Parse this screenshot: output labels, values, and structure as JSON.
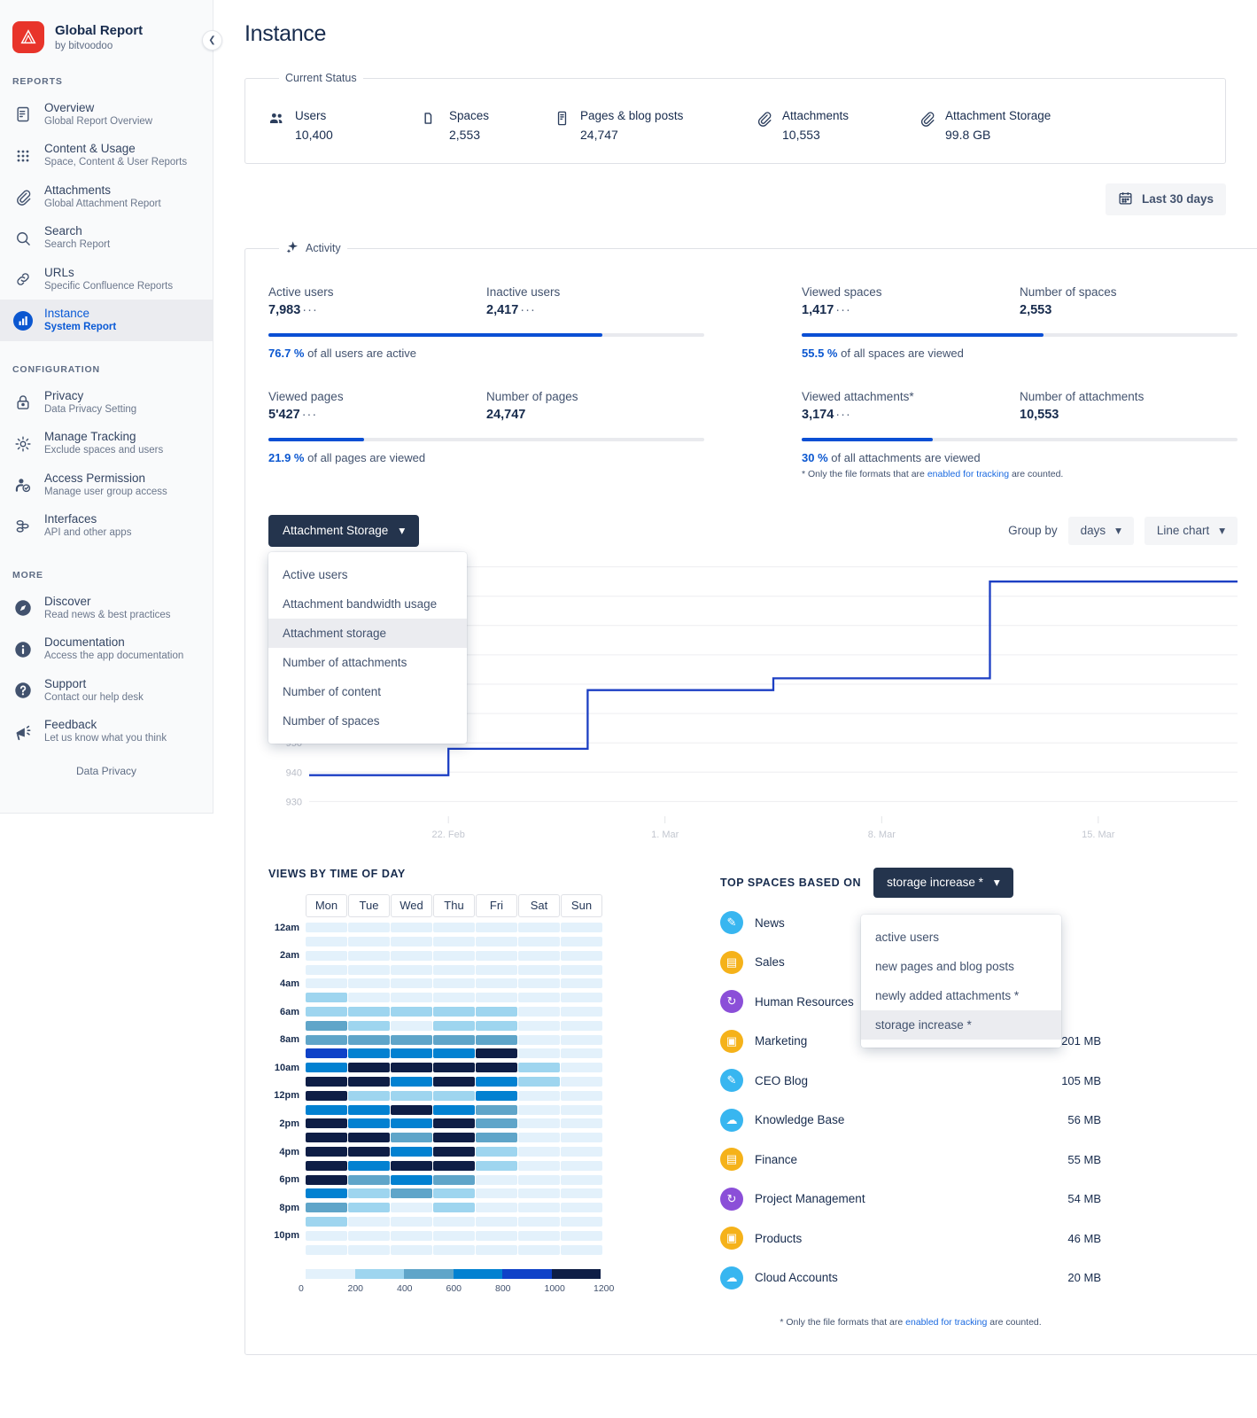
{
  "sidebar": {
    "brand": {
      "title": "Global Report",
      "subtitle": "by bitvoodoo"
    },
    "sections": [
      {
        "label": "REPORTS",
        "items": [
          {
            "title": "Overview",
            "subtitle": "Global Report Overview",
            "icon": "document-icon",
            "active": false
          },
          {
            "title": "Content & Usage",
            "subtitle": "Space, Content & User Reports",
            "icon": "grid-icon",
            "active": false
          },
          {
            "title": "Attachments",
            "subtitle": "Global Attachment Report",
            "icon": "paperclip-icon",
            "active": false
          },
          {
            "title": "Search",
            "subtitle": "Search Report",
            "icon": "search-icon",
            "active": false
          },
          {
            "title": "URLs",
            "subtitle": "Specific Confluence Reports",
            "icon": "link-icon",
            "active": false
          },
          {
            "title": "Instance",
            "subtitle": "System Report",
            "icon": "chart-icon",
            "active": true
          }
        ]
      },
      {
        "label": "CONFIGURATION",
        "items": [
          {
            "title": "Privacy",
            "subtitle": "Data Privacy Setting",
            "icon": "lock-icon",
            "active": false
          },
          {
            "title": "Manage Tracking",
            "subtitle": "Exclude spaces and users",
            "icon": "gear-icon",
            "active": false
          },
          {
            "title": "Access Permission",
            "subtitle": "Manage user group access",
            "icon": "user-check-icon",
            "active": false
          },
          {
            "title": "Interfaces",
            "subtitle": "API and other apps",
            "icon": "nodes-icon",
            "active": false
          }
        ]
      },
      {
        "label": "MORE",
        "items": [
          {
            "title": "Discover",
            "subtitle": "Read news & best practices",
            "icon": "compass-icon",
            "active": false
          },
          {
            "title": "Documentation",
            "subtitle": "Access the app documentation",
            "icon": "info-icon",
            "active": false
          },
          {
            "title": "Support",
            "subtitle": "Contact our help desk",
            "icon": "question-icon",
            "active": false
          },
          {
            "title": "Feedback",
            "subtitle": "Let us know what you think",
            "icon": "megaphone-icon",
            "active": false
          }
        ]
      }
    ],
    "footer_link": "Data Privacy",
    "collapse_icon": "chevron-left-icon"
  },
  "header": {
    "title": "Instance"
  },
  "current_status": {
    "legend": "Current Status",
    "items": [
      {
        "label": "Users",
        "value": "10,400",
        "icon": "users-icon"
      },
      {
        "label": "Spaces",
        "value": "2,553",
        "icon": "folder-icon"
      },
      {
        "label": "Pages & blog posts",
        "value": "24,747",
        "icon": "page-icon"
      },
      {
        "label": "Attachments",
        "value": "10,553",
        "icon": "paperclip-icon"
      },
      {
        "label": "Attachment Storage",
        "value": "99.8 GB",
        "icon": "paperclip-icon"
      }
    ]
  },
  "date_range": {
    "label": "Last 30 days",
    "icon": "calendar-icon"
  },
  "activity": {
    "legend": "Activity",
    "legend_icon": "sparkle-icon",
    "cells": [
      {
        "left_label": "Active users",
        "left_value": "7,983",
        "left_dots": "···",
        "right_label": "Inactive users",
        "right_value": "2,417",
        "right_dots": "···",
        "percent": 76.7,
        "caption_value": "76.7 %",
        "caption_text": "of all users are active"
      },
      {
        "left_label": "Viewed spaces",
        "left_value": "1,417",
        "left_dots": "···",
        "right_label": "Number of spaces",
        "right_value": "2,553",
        "right_dots": "",
        "percent": 55.5,
        "caption_value": "55.5 %",
        "caption_text": "of all spaces are viewed"
      },
      {
        "left_label": "Viewed pages",
        "left_value": "5'427",
        "left_dots": "···",
        "right_label": "Number of pages",
        "right_value": "24,747",
        "right_dots": "",
        "percent": 21.9,
        "caption_value": "21.9 %",
        "caption_text": "of all pages are viewed"
      },
      {
        "left_label": "Viewed attachments*",
        "left_value": "3,174",
        "left_dots": "···",
        "right_label": "Number of attachments",
        "right_value": "10,553",
        "right_dots": "",
        "percent": 30,
        "caption_value": "30 %",
        "caption_text": "of all attachments are viewed",
        "note_pre": "* Only the file formats that are ",
        "note_link": "enabled for tracking",
        "note_post": " are counted."
      }
    ]
  },
  "chart_controls": {
    "metric_button": "Attachment Storage",
    "metric_menu_open": true,
    "metric_options": [
      "Active users",
      "Attachment bandwidth usage",
      "Attachment storage",
      "Number of attachments",
      "Number of content",
      "Number of spaces"
    ],
    "metric_selected": "Attachment storage",
    "group_by_label": "Group by",
    "group_by_value": "days",
    "chart_type_value": "Line chart",
    "chevron_icon": "chevron-down-icon"
  },
  "chart_data": {
    "type": "line",
    "title": "Attachment Storage",
    "xlabel": "",
    "ylabel": "",
    "grid": true,
    "legend": "none",
    "step": true,
    "line_color": "#1c3fc4",
    "xticks": [
      "22. Feb",
      "1. Mar",
      "8. Mar",
      "15. Mar"
    ],
    "yticks": [
      930,
      940,
      950,
      960,
      970,
      980,
      990,
      1000,
      1010
    ],
    "ylim": [
      925,
      1012
    ],
    "xlim": [
      0,
      30
    ],
    "x": [
      0,
      4.5,
      9,
      15,
      22,
      30
    ],
    "values": [
      939,
      948,
      968,
      972,
      1005,
      1005
    ],
    "series": [
      {
        "name": "Attachment storage (GB)",
        "values": [
          939,
          939,
          948,
          948,
          968,
          968,
          972,
          972,
          1005,
          1005
        ]
      }
    ]
  },
  "heatmap": {
    "title": "VIEWS BY TIME OF DAY",
    "days": [
      "Mon",
      "Tue",
      "Wed",
      "Thu",
      "Fri",
      "Sat",
      "Sun"
    ],
    "hour_labels": [
      "12am",
      "",
      "2am",
      "",
      "4am",
      "",
      "6am",
      "",
      "8am",
      "",
      "10am",
      "",
      "12pm",
      "",
      "2pm",
      "",
      "4pm",
      "",
      "6pm",
      "",
      "8pm",
      "",
      "10pm",
      ""
    ],
    "legend_ticks": [
      0,
      200,
      400,
      600,
      800,
      1000,
      1200
    ],
    "legend_colors": [
      "#e3f1fb",
      "#9ed5ef",
      "#5fa5c9",
      "#0281d1",
      "#0f42c8",
      "#0e1e46"
    ],
    "values": [
      [
        120,
        110,
        115,
        110,
        115,
        100,
        100
      ],
      [
        120,
        110,
        110,
        105,
        110,
        100,
        100
      ],
      [
        120,
        110,
        110,
        105,
        110,
        100,
        100
      ],
      [
        125,
        115,
        110,
        110,
        115,
        100,
        100
      ],
      [
        130,
        120,
        115,
        115,
        120,
        105,
        100
      ],
      [
        330,
        140,
        130,
        130,
        135,
        110,
        105
      ],
      [
        360,
        340,
        345,
        340,
        345,
        130,
        120
      ],
      [
        520,
        330,
        150,
        330,
        330,
        130,
        120
      ],
      [
        540,
        530,
        530,
        530,
        530,
        140,
        125
      ],
      [
        800,
        790,
        790,
        790,
        1000,
        140,
        125
      ],
      [
        790,
        1000,
        1000,
        1000,
        1000,
        350,
        130
      ],
      [
        1000,
        1000,
        790,
        1000,
        790,
        345,
        130
      ],
      [
        1000,
        330,
        330,
        330,
        790,
        135,
        125
      ],
      [
        790,
        790,
        1000,
        790,
        540,
        135,
        125
      ],
      [
        1000,
        790,
        790,
        1000,
        540,
        135,
        125
      ],
      [
        1200,
        1200,
        560,
        1000,
        530,
        130,
        120
      ],
      [
        1200,
        1200,
        790,
        1200,
        350,
        130,
        120
      ],
      [
        1200,
        790,
        1000,
        1000,
        340,
        125,
        120
      ],
      [
        1000,
        540,
        790,
        540,
        130,
        120,
        115
      ],
      [
        790,
        340,
        540,
        330,
        125,
        120,
        115
      ],
      [
        540,
        330,
        120,
        330,
        120,
        115,
        110
      ],
      [
        345,
        125,
        115,
        120,
        115,
        110,
        110
      ],
      [
        130,
        115,
        112,
        115,
        112,
        108,
        105
      ],
      [
        120,
        112,
        110,
        112,
        110,
        105,
        105
      ]
    ]
  },
  "top_spaces": {
    "title": "TOP SPACES BASED ON",
    "selector_value": "storage increase *",
    "menu_open": true,
    "menu_options": [
      "active users",
      "new pages and blog posts",
      "newly added attachments *",
      "storage increase *"
    ],
    "menu_selected": "storage increase *",
    "rows": [
      {
        "name": "News",
        "value": "",
        "icon": "notebook-icon",
        "color": "#38b6f0"
      },
      {
        "name": "Sales",
        "value": "",
        "icon": "wallet-icon",
        "color": "#f5b21a"
      },
      {
        "name": "Human Resources",
        "value": "",
        "icon": "sync-icon",
        "color": "#8b4fd8"
      },
      {
        "name": "Marketing",
        "value": "201 MB",
        "icon": "image-icon",
        "color": "#f5b21a"
      },
      {
        "name": "CEO Blog",
        "value": "105 MB",
        "icon": "notebook-icon",
        "color": "#38b6f0"
      },
      {
        "name": "Knowledge Base",
        "value": "56 MB",
        "icon": "cloud-icon",
        "color": "#38b6f0"
      },
      {
        "name": "Finance",
        "value": "55 MB",
        "icon": "wallet-icon",
        "color": "#f5b21a"
      },
      {
        "name": "Project Management",
        "value": "54 MB",
        "icon": "sync-icon",
        "color": "#8b4fd8"
      },
      {
        "name": "Products",
        "value": "46 MB",
        "icon": "image-icon",
        "color": "#f5b21a"
      },
      {
        "name": "Cloud Accounts",
        "value": "20 MB",
        "icon": "cloud-icon",
        "color": "#38b6f0"
      }
    ],
    "note_pre": "* Only the file formats that are ",
    "note_link": "enabled for tracking",
    "note_post": " are counted."
  }
}
